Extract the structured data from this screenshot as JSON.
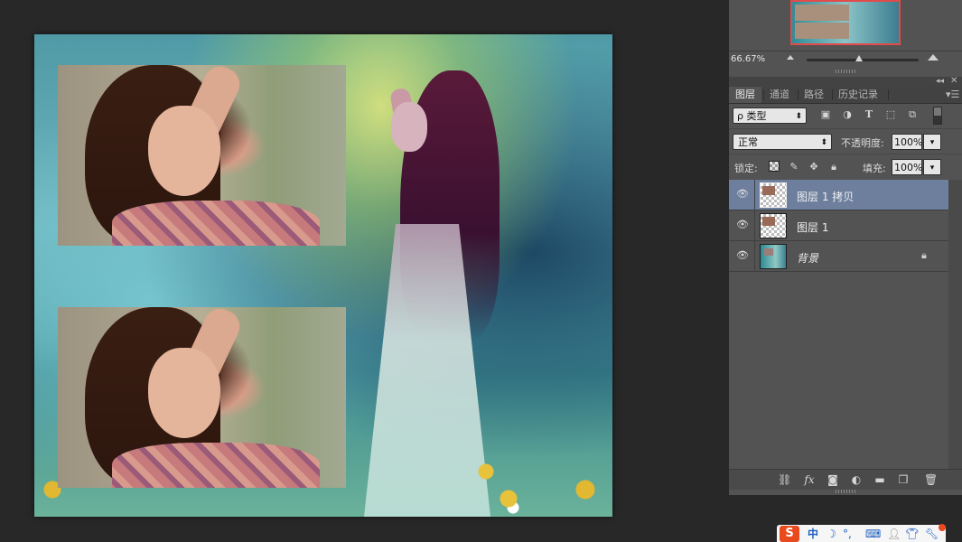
{
  "canvas": {
    "description_hidden": ""
  },
  "navigator": {
    "zoom": "66.67%"
  },
  "panel": {
    "tabs": [
      {
        "label": "图层"
      },
      {
        "label": "通道"
      },
      {
        "label": "路径"
      },
      {
        "label": "历史记录"
      }
    ],
    "filter": {
      "kind_label": "ρ 类型"
    },
    "blend_mode": "正常",
    "opacity_label": "不透明度:",
    "opacity_value": "100%",
    "lock_label": "锁定:",
    "fill_label": "填充:",
    "fill_value": "100%"
  },
  "layers": [
    {
      "name": "图层 1 拷贝",
      "selected": true,
      "visible": true
    },
    {
      "name": "图层 1",
      "selected": false,
      "visible": true
    },
    {
      "name": "背景",
      "selected": false,
      "visible": true,
      "locked": true
    }
  ],
  "ime": {
    "logo": "S",
    "mode": "中"
  }
}
